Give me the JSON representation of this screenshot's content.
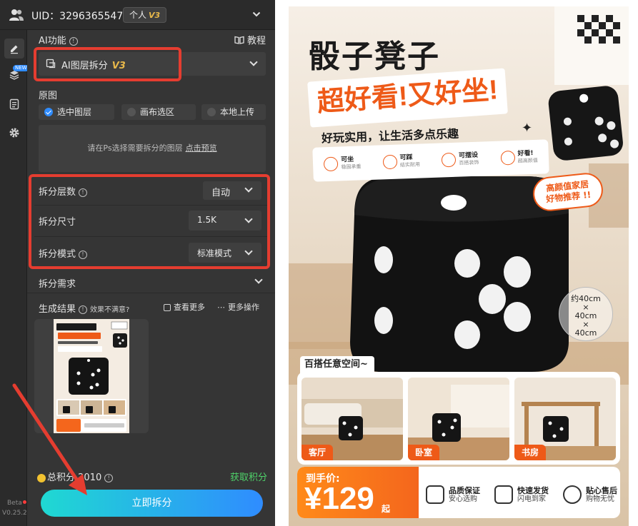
{
  "header": {
    "uid_text": "UID：3296365547",
    "plan_label": "个人",
    "plan_tier": "V3"
  },
  "rail": {
    "new_badge": "NEW",
    "beta_label": "Beta",
    "version": "V0.25.2"
  },
  "ai_function": {
    "label": "AI功能",
    "tutorial": "教程",
    "selected": "AI图层拆分",
    "selected_tier": "V3"
  },
  "source": {
    "label": "原图",
    "options": [
      "选中图层",
      "画布选区",
      "本地上传"
    ],
    "hint": "请在Ps选择需要拆分的图层",
    "preview_link": "点击预览"
  },
  "settings": {
    "layers_label": "拆分层数",
    "layers_value": "自动",
    "size_label": "拆分尺寸",
    "size_value": "1.5K",
    "mode_label": "拆分模式",
    "mode_value": "标准模式"
  },
  "requirements_label": "拆分需求",
  "results": {
    "label": "生成结果",
    "unsatisfied": "效果不满意?",
    "see_more": "查看更多",
    "more_actions": "更多操作"
  },
  "footer": {
    "points_label": "总积分",
    "points_value": "2010",
    "get_points": "获取积分",
    "cta": "立即拆分"
  },
  "poster": {
    "title": "骰子凳子",
    "subtitle": "超好看!又好坐!",
    "slogan": "好玩实用，让生活多点乐趣",
    "features": [
      {
        "title": "可坐",
        "sub": "稳固承重"
      },
      {
        "title": "可踩",
        "sub": "结实耐用"
      },
      {
        "title": "可摆设",
        "sub": "百搭装饰"
      },
      {
        "title": "好看!",
        "sub": "超高颜值"
      }
    ],
    "bubble_line1": "高颜值家居",
    "bubble_line2": "好物推荐 !!",
    "size_lines": [
      "约40cm",
      "×",
      "40cm",
      "×",
      "40cm"
    ],
    "space_label": "百搭任意空间~",
    "scenes": [
      "客厅",
      "卧室",
      "书房"
    ],
    "price_label": "到手价:",
    "price_value": "¥129",
    "price_unit": "起",
    "services": [
      {
        "title": "品质保证",
        "sub": "安心选购"
      },
      {
        "title": "快速发货",
        "sub": "闪电到家"
      },
      {
        "title": "贴心售后",
        "sub": "购物无忧"
      }
    ]
  },
  "colors": {
    "panel_bg": "#353535",
    "highlight_red": "#e53d30",
    "accent_blue": "#2f8cff",
    "points_green": "#4fd36a",
    "poster_orange": "#ee5a18"
  }
}
